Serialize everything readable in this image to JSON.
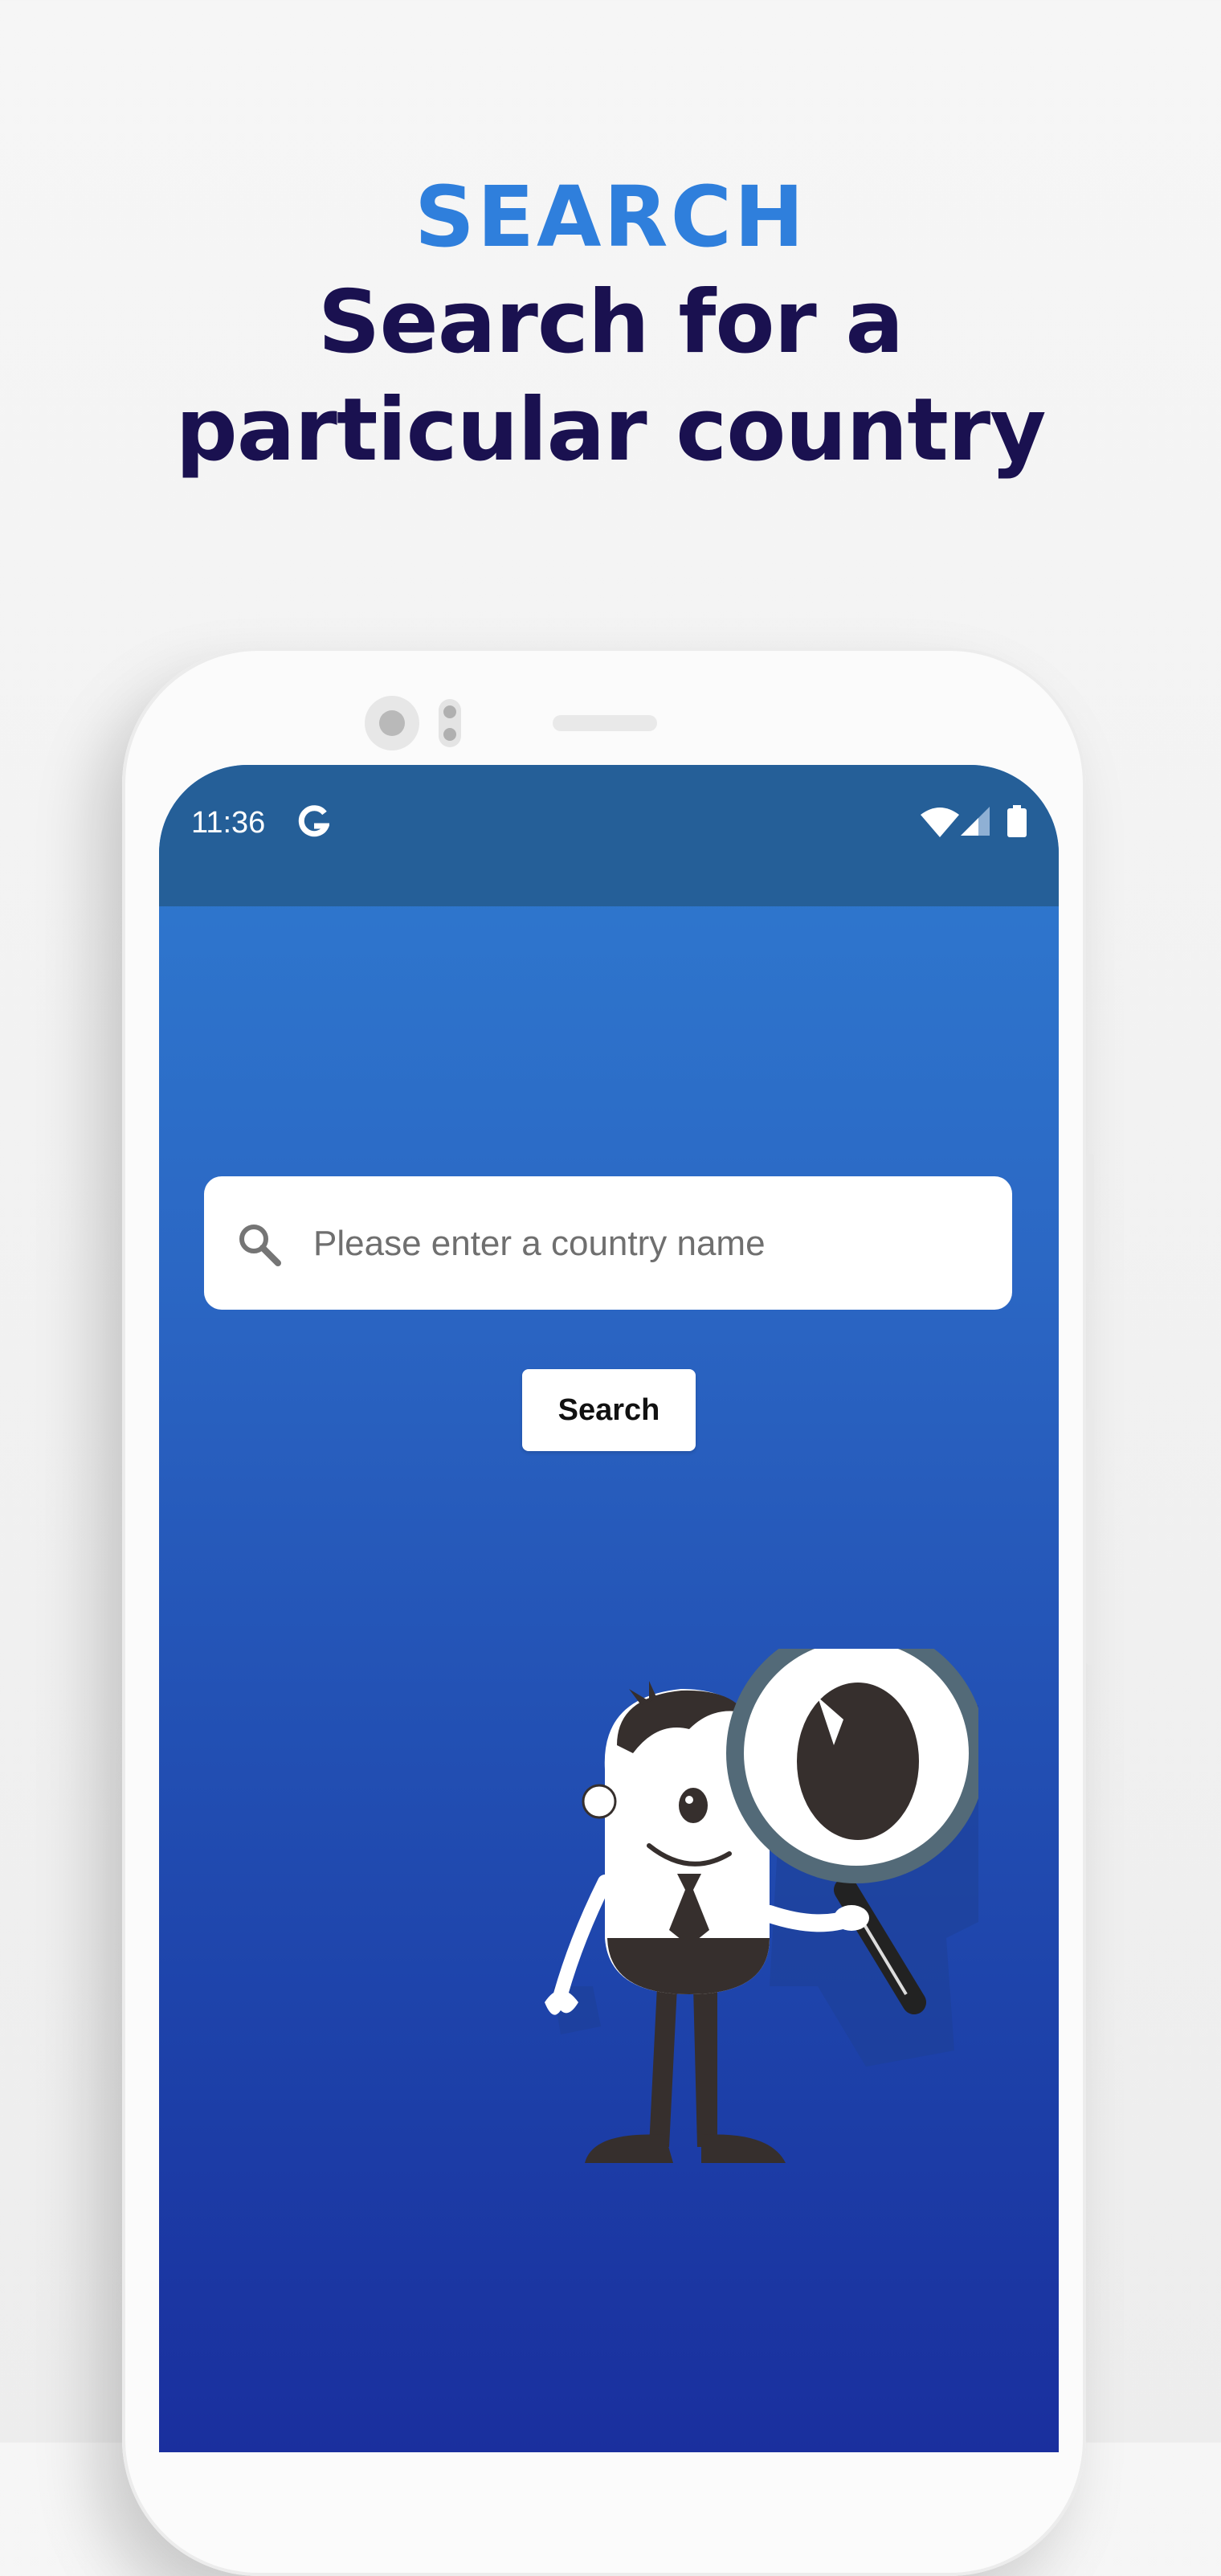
{
  "promo": {
    "tag": "SEARCH",
    "title_line1": "Search for a",
    "title_line2": "particular country"
  },
  "colors": {
    "tag": "#2f7fdc",
    "title": "#1a1150",
    "status_bar": "#255f98",
    "screen_top": "#2f7bd0",
    "screen_bottom": "#1a2f9e"
  },
  "status_bar": {
    "time": "11:36",
    "icons": [
      "google-icon",
      "wifi-icon",
      "signal-icon",
      "battery-icon"
    ]
  },
  "search": {
    "placeholder": "Please enter a country name",
    "value": "",
    "icon": "search-icon",
    "button_label": "Search"
  },
  "illustration": {
    "icon": "magnifier-mascot-illustration"
  }
}
